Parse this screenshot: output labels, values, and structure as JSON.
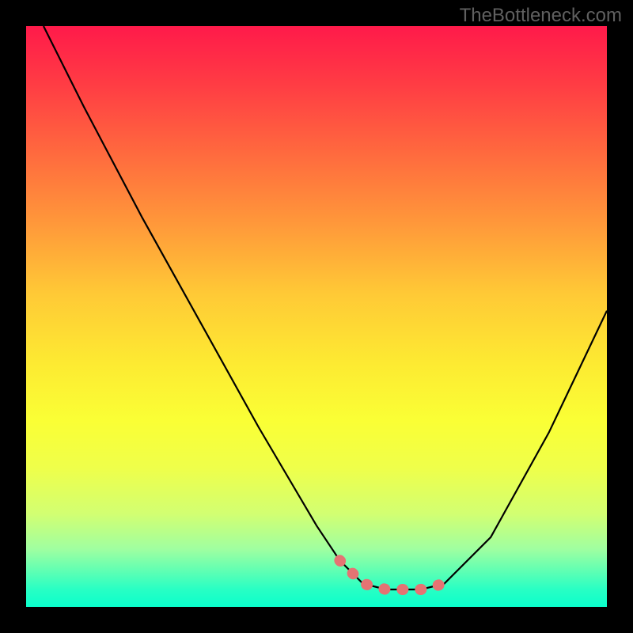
{
  "watermark": "TheBottleneck.com",
  "chart_data": {
    "type": "line",
    "title": "",
    "xlabel": "",
    "ylabel": "",
    "xlim": [
      0,
      100
    ],
    "ylim": [
      0,
      100
    ],
    "series": [
      {
        "name": "curve",
        "x": [
          3,
          10,
          20,
          30,
          40,
          50,
          54,
          58,
          62,
          68,
          72,
          80,
          90,
          100
        ],
        "values": [
          100,
          86,
          67,
          49,
          31,
          14,
          8,
          4,
          3,
          3,
          4,
          12,
          30,
          51
        ]
      }
    ],
    "highlight": {
      "name": "bottom-highlight",
      "color": "#e57373",
      "x": [
        54,
        58,
        62,
        68,
        72
      ],
      "values": [
        8,
        4,
        3,
        3,
        4
      ]
    },
    "colors": {
      "background_top": "#ff1a4a",
      "background_bottom": "#0affcc",
      "frame": "#000000",
      "curve": "#000000",
      "highlight": "#e57373"
    }
  }
}
